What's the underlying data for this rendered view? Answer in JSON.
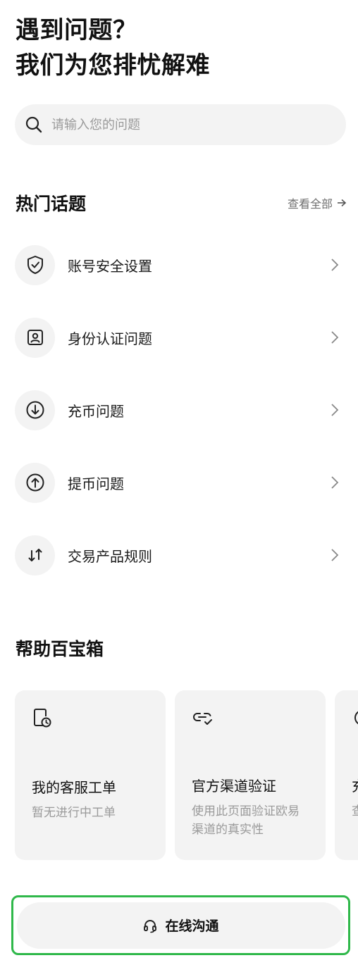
{
  "hero": {
    "line1": "遇到问题？",
    "line2": "我们为您排忧解难"
  },
  "search": {
    "placeholder": "请输入您的问题",
    "value": "",
    "icon": "search-icon"
  },
  "hot_topics": {
    "title": "热门话题",
    "see_all_label": "查看全部",
    "items": [
      {
        "label": "账号安全设置",
        "icon": "shield-check-icon"
      },
      {
        "label": "身份认证问题",
        "icon": "id-card-icon"
      },
      {
        "label": "充币问题",
        "icon": "deposit-arrow-down-icon"
      },
      {
        "label": "提币问题",
        "icon": "withdraw-arrow-up-icon"
      },
      {
        "label": "交易产品规则",
        "icon": "swap-arrows-icon"
      }
    ]
  },
  "toolbox": {
    "title": "帮助百宝箱",
    "cards": [
      {
        "title": "我的客服工单",
        "desc": "暂无进行中工单",
        "icon": "ticket-clock-icon"
      },
      {
        "title": "官方渠道验证",
        "desc": "使用此页面验证欧易渠道的真实性",
        "icon": "link-check-icon"
      },
      {
        "title": "充",
        "desc": "查",
        "icon": "partial-card-icon"
      }
    ]
  },
  "cta": {
    "label": "在线沟通",
    "icon": "headset-icon"
  },
  "colors": {
    "text": "#111111",
    "muted": "#9a9a9a",
    "surface": "#f3f3f3",
    "highlight_border": "#2fb84a"
  }
}
